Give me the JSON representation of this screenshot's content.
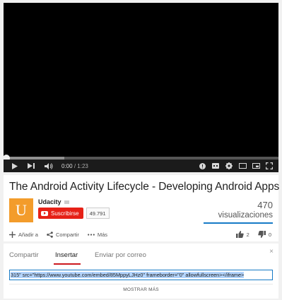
{
  "player": {
    "current_time": "0:00",
    "separator": "/",
    "duration": "1:23",
    "buffered_fraction": 0.22
  },
  "video": {
    "title": "The Android Activity Lifecycle - Developing Android Apps",
    "channel_name": "Udacity",
    "channel_logo_letter": "U",
    "subscribe_label": "Suscribirse",
    "subscriber_count": "49.791",
    "view_count": "470",
    "views_label": "visualizaciones"
  },
  "actions": {
    "add_to_label": "Añadir a",
    "share_label": "Compartir",
    "more_label": "Más",
    "likes": "2",
    "dislikes": "0"
  },
  "share": {
    "tabs": [
      "Compartir",
      "Insertar",
      "Enviar por correo"
    ],
    "active_tab": "Insertar",
    "close_symbol": "×",
    "embed_code": "315\" src=\"https://www.youtube.com/embed/85MppyLJHz0\" frameborder=\"0\" allowfullscreen></iframe>",
    "show_more_label": "MOSTRAR MÁS"
  },
  "colors": {
    "subscribe_red": "#e62117",
    "accent_blue": "#167ac6",
    "tab_red": "#cc181e",
    "logo_orange": "#f39c2b"
  },
  "icons": [
    "play-icon",
    "next-icon",
    "volume-icon",
    "annotations-icon",
    "captions-icon",
    "settings-icon",
    "theater-icon",
    "cast-icon",
    "fullscreen-icon",
    "plus-icon",
    "share-icon",
    "more-dots-icon",
    "thumbs-up-icon",
    "thumbs-down-icon",
    "close-icon"
  ]
}
